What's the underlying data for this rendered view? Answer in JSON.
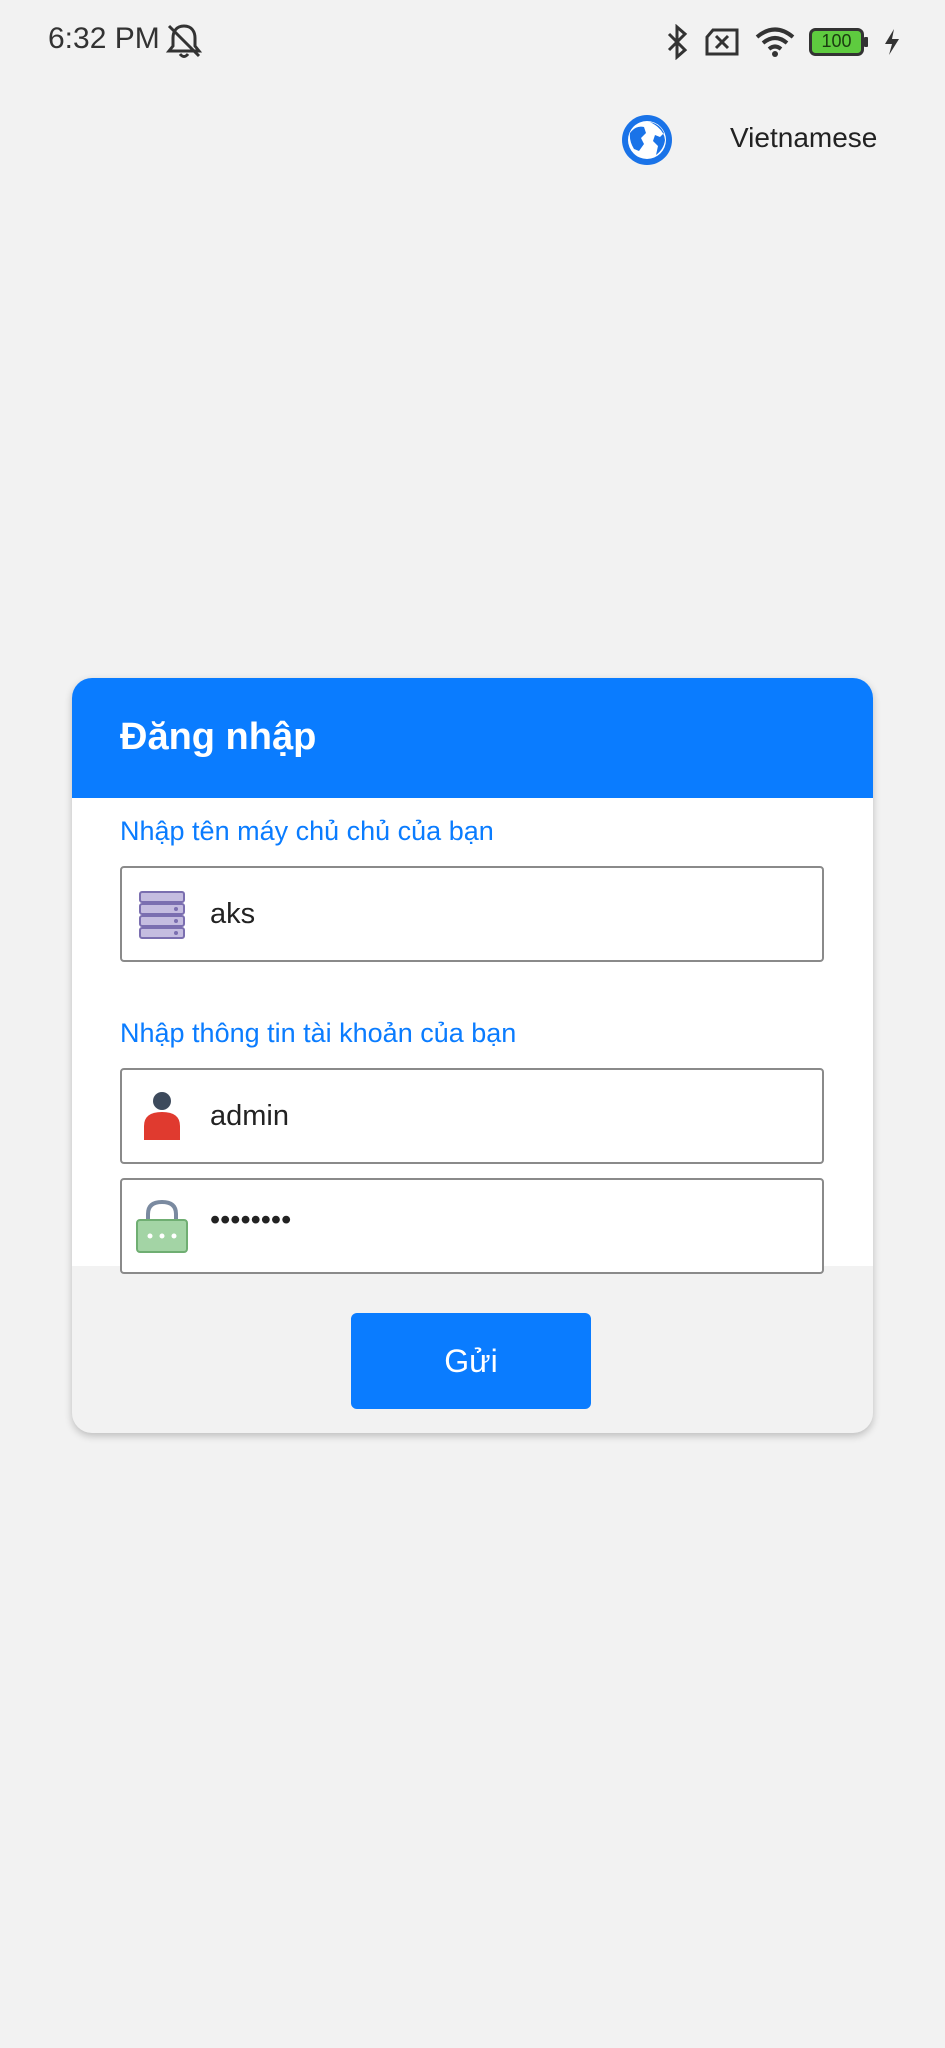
{
  "status_bar": {
    "time": "6:32 PM",
    "battery": "100",
    "icons": [
      "mute-bell-icon",
      "bluetooth-icon",
      "sim-off-icon",
      "wifi-icon",
      "battery-icon",
      "charging-icon"
    ]
  },
  "language": {
    "label": "Vietnamese",
    "icon": "globe-icon"
  },
  "login": {
    "title": "Đăng nhập",
    "server_section_label": "Nhập tên máy chủ chủ của bạn",
    "server_value": "aks",
    "account_section_label": "Nhập thông tin tài khoản của bạn",
    "username_value": "admin",
    "password_value": "••••••••",
    "submit_label": "Gửi"
  },
  "colors": {
    "accent": "#0a7cff",
    "background": "#f2f2f2"
  }
}
